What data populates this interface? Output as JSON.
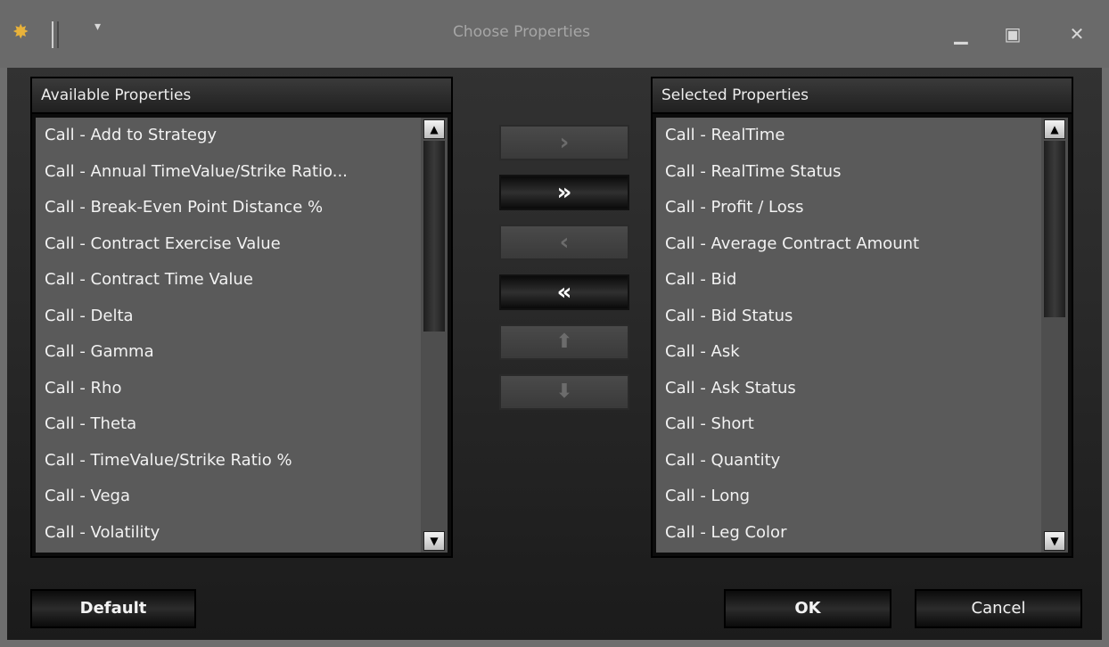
{
  "window": {
    "title": "Choose Properties",
    "app_icon": "bee-icon",
    "quick_access": "▾",
    "min_icon": "minimize-icon",
    "max_icon": "maximize-icon",
    "close_icon": "close-icon"
  },
  "available": {
    "header": "Available Properties",
    "items": [
      "Call - Add to Strategy",
      "Call - Annual TimeValue/Strike Ratio...",
      "Call - Break-Even Point Distance %",
      "Call - Contract Exercise Value",
      "Call - Contract Time Value",
      "Call - Delta",
      "Call - Gamma",
      "Call - Rho",
      "Call - Theta",
      "Call - TimeValue/Strike Ratio %",
      "Call - Vega",
      "Call - Volatility"
    ]
  },
  "selected": {
    "header": "Selected Properties",
    "items": [
      "Call - RealTime",
      "Call - RealTime Status",
      "Call - Profit / Loss",
      "Call - Average Contract Amount",
      "Call - Bid",
      "Call - Bid Status",
      "Call - Ask",
      "Call - Ask Status",
      "Call - Short",
      "Call - Quantity",
      "Call - Long",
      "Call - Leg Color"
    ]
  },
  "transfer": {
    "add_one": "›",
    "add_all": "»",
    "remove_one": "‹",
    "remove_all": "«",
    "move_up": "⬆",
    "move_down": "⬇"
  },
  "buttons": {
    "default": "Default",
    "ok": "OK",
    "cancel": "Cancel"
  }
}
